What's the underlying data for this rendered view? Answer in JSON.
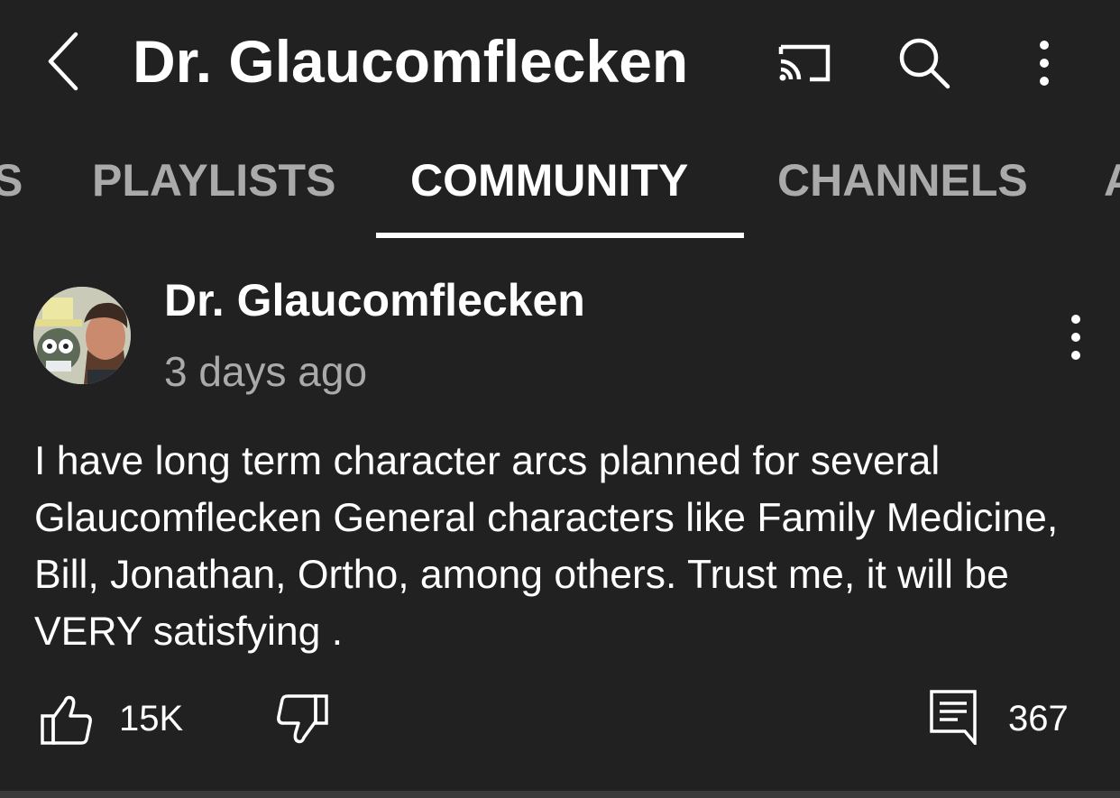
{
  "header": {
    "title": "Dr. Glaucomflecken",
    "icons": [
      "back-icon",
      "cast-icon",
      "search-icon",
      "more-vert-icon"
    ]
  },
  "tabs": [
    {
      "label": "S",
      "active": false
    },
    {
      "label": "PLAYLISTS",
      "active": false
    },
    {
      "label": "COMMUNITY",
      "active": true
    },
    {
      "label": "CHANNELS",
      "active": false
    },
    {
      "label": "A",
      "active": false
    }
  ],
  "post": {
    "author": "Dr. Glaucomflecken",
    "time": "3 days ago",
    "text": "I have long term character arcs planned for several Glaucomflecken General characters like Family Medicine, Bill, Jonathan, Ortho, among others. Trust me, it will be VERY satisfying .",
    "likes": "15K",
    "comments": "367"
  },
  "colors": {
    "background": "#212121",
    "text_primary": "#ffffff",
    "text_secondary": "#aaaaaa"
  }
}
